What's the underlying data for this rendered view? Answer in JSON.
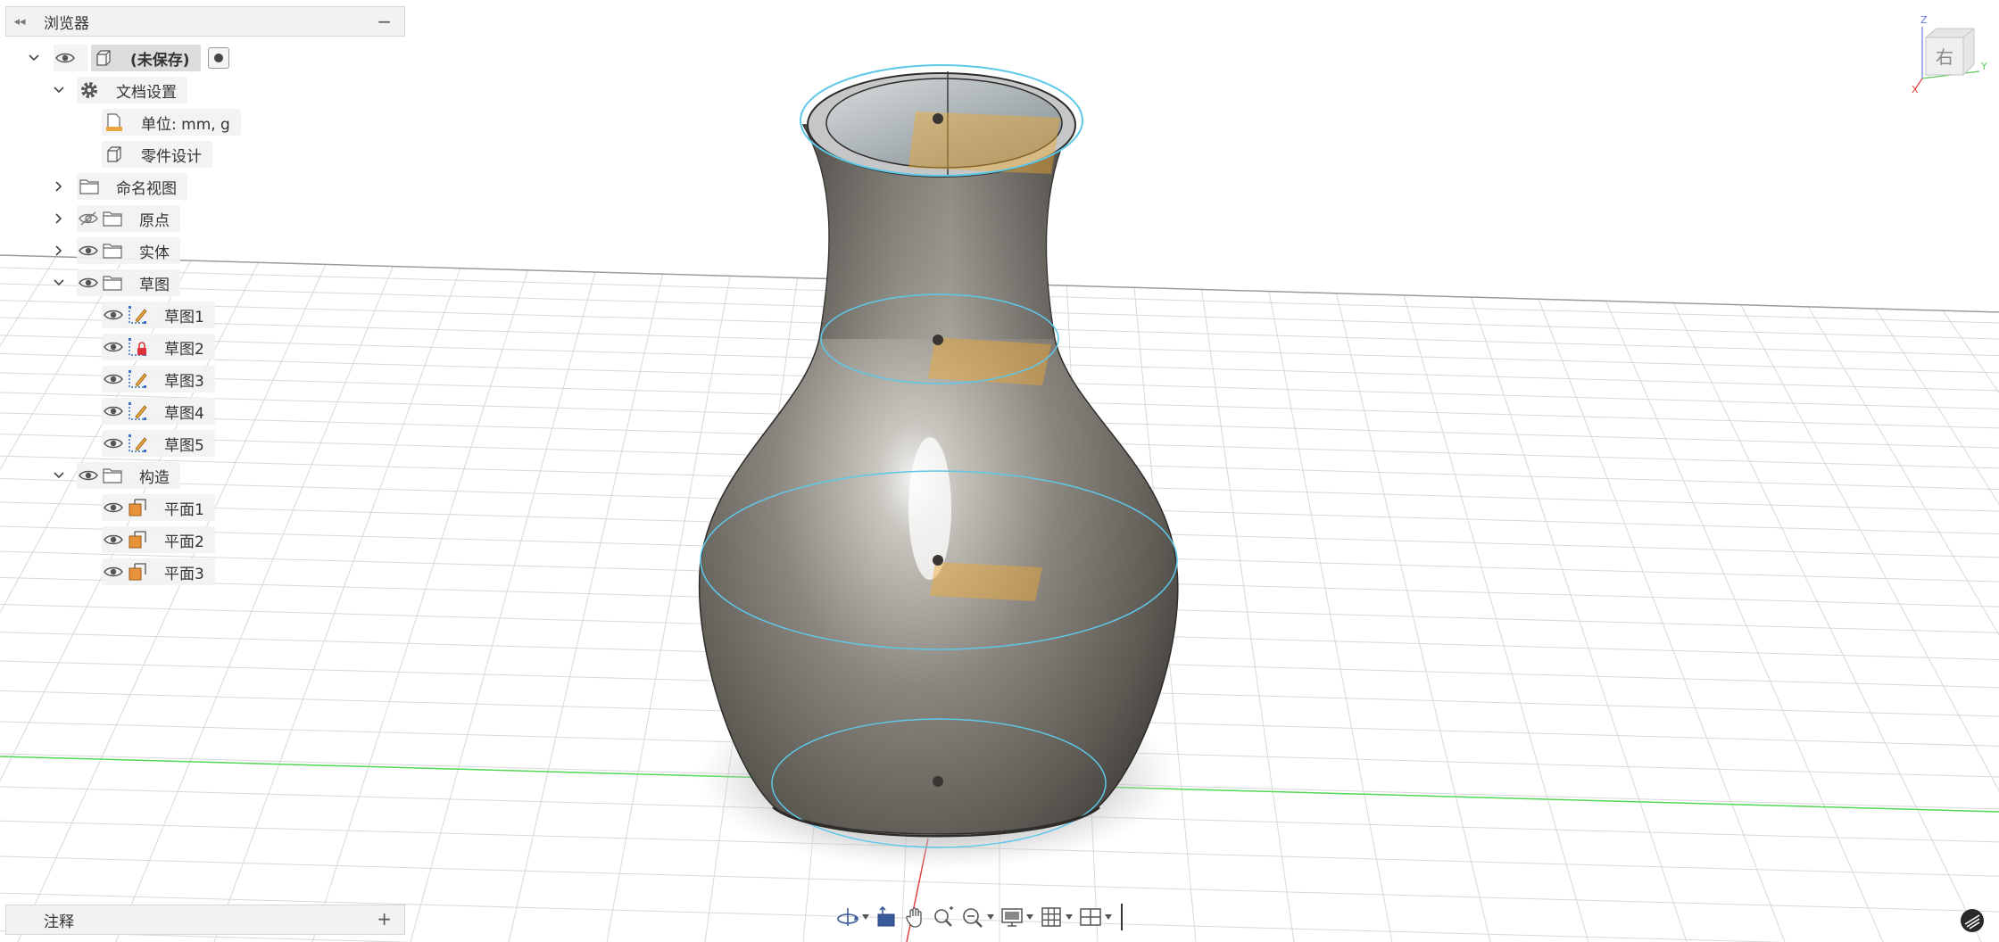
{
  "browser": {
    "title": "浏览器",
    "collapse_glyph": "◂◂",
    "minimize_glyph": "−",
    "root": {
      "label": "(未保存)"
    },
    "items": [
      {
        "label": "文档设置"
      },
      {
        "label": "单位: mm, g"
      },
      {
        "label": "零件设计"
      },
      {
        "label": "命名视图"
      },
      {
        "label": "原点"
      },
      {
        "label": "实体"
      },
      {
        "label": "草图"
      },
      {
        "label": "草图1"
      },
      {
        "label": "草图2"
      },
      {
        "label": "草图3"
      },
      {
        "label": "草图4"
      },
      {
        "label": "草图5"
      },
      {
        "label": "构造"
      },
      {
        "label": "平面1"
      },
      {
        "label": "平面2"
      },
      {
        "label": "平面3"
      }
    ]
  },
  "comments": {
    "title": "注释",
    "add_glyph": "+"
  },
  "viewcube": {
    "face_label": "右",
    "axis_z": "Z",
    "axis_y": "Y",
    "axis_x": "X"
  },
  "toolbar": {
    "icons": [
      "orbit-icon",
      "look-at-icon",
      "pan-icon",
      "zoom-icon",
      "fit-icon",
      "display-settings-icon",
      "grid-icon",
      "viewports-icon"
    ]
  },
  "colors": {
    "vase_body": "#8a857e",
    "sketch_line": "#5ec8e8",
    "plane": "#f0a830",
    "grid_line": "#d8d8d8",
    "axis_green": "#4ed84e",
    "axis_red": "#e04040"
  }
}
